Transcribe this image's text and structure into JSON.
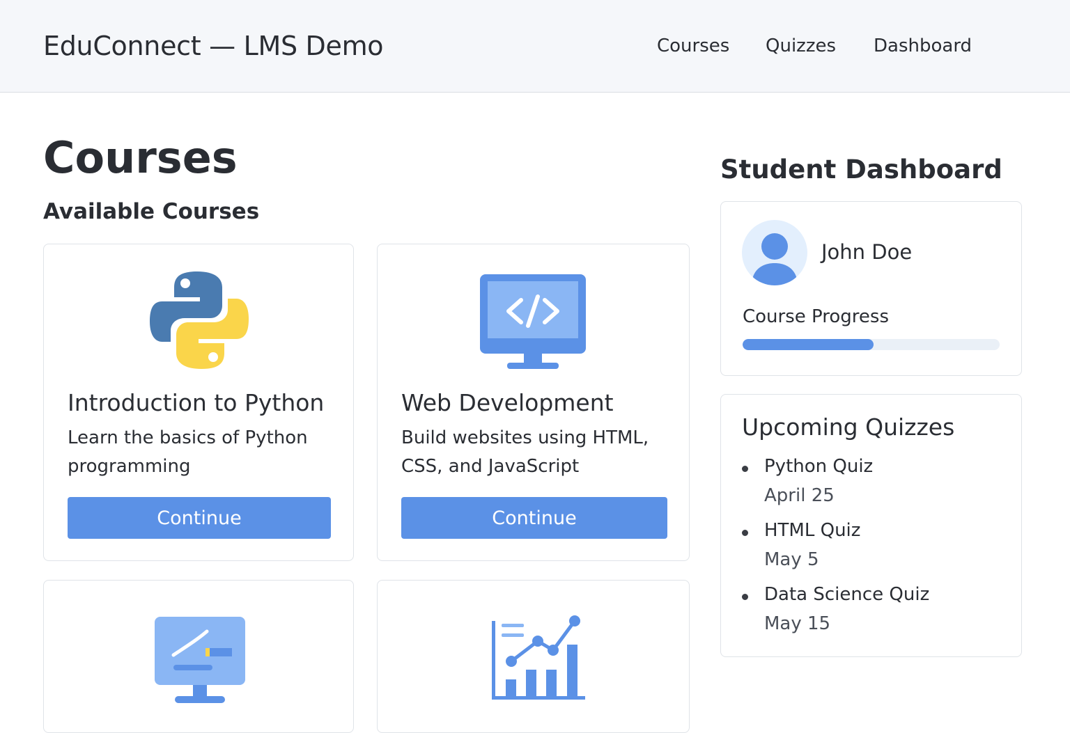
{
  "header": {
    "brand": "EduConnect — LMS Demo",
    "nav": [
      "Courses",
      "Quizzes",
      "Dashboard"
    ]
  },
  "main": {
    "title": "Courses",
    "subtitle": "Available Courses",
    "courses": [
      {
        "title": "Introduction to Python",
        "description": "Learn the basics of Python programming",
        "button": "Continue",
        "icon": "python-logo-icon"
      },
      {
        "title": "Web Development",
        "description": "Build websites using HTML, CSS, and JavaScript",
        "button": "Continue",
        "icon": "code-monitor-icon"
      },
      {
        "icon": "whiteboard-monitor-icon"
      },
      {
        "icon": "analytics-chart-icon"
      }
    ]
  },
  "dashboard": {
    "title": "Student Dashboard",
    "student": {
      "name": "John Doe",
      "progress_label": "Course Progress",
      "progress_percent": 51
    },
    "quizzes": {
      "heading": "Upcoming Quizzes",
      "items": [
        {
          "name": "Python Quiz",
          "date": "April 25"
        },
        {
          "name": "HTML Quiz",
          "date": "May 5"
        },
        {
          "name": "Data Science Quiz",
          "date": "May 15"
        }
      ]
    }
  },
  "colors": {
    "accent": "#5b91e6",
    "header_bg": "#f5f7fa",
    "python_blue": "#4a7bb0",
    "python_yellow": "#fad54a"
  }
}
